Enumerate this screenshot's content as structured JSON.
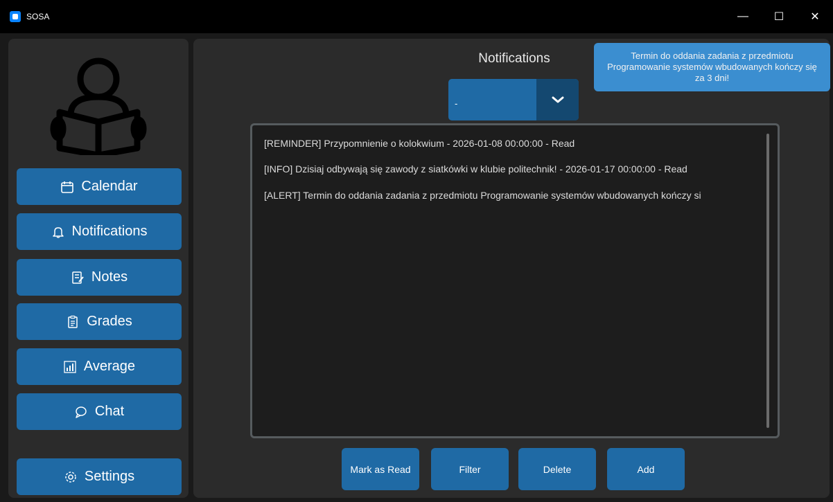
{
  "window": {
    "title": "SOSA",
    "minimize": "—",
    "maximize": "☐",
    "close": "✕"
  },
  "sidebar": {
    "items": [
      {
        "label": "Calendar",
        "icon": "calendar-icon",
        "glyph": "📅"
      },
      {
        "label": "Notifications",
        "icon": "bell-icon",
        "glyph": "🔔"
      },
      {
        "label": "Notes",
        "icon": "notes-icon",
        "glyph": "📝"
      },
      {
        "label": "Grades",
        "icon": "grades-icon",
        "glyph": "📋"
      },
      {
        "label": "Average",
        "icon": "chart-icon",
        "glyph": "📊"
      },
      {
        "label": "Chat",
        "icon": "chat-icon",
        "glyph": "💬"
      }
    ],
    "settings": {
      "label": "Settings",
      "icon": "gear-icon",
      "glyph": "⚙"
    }
  },
  "main": {
    "title": "Notifications",
    "filter_dropdown": {
      "value": "-"
    },
    "toast": "Termin do oddania zadania z przedmiotu Programowanie systemów wbudowanych kończy się za 3 dni!",
    "notifications": [
      "[REMINDER] Przypomnienie o kolokwium - 2026-01-08 00:00:00 - Read",
      "[INFO] Dzisiaj odbywają się zawody z siatkówki w klubie politechnik!  - 2026-01-17 00:00:00 - Read",
      "[ALERT] Termin do oddania zadania z przedmiotu Programowanie systemów wbudowanych kończy si"
    ],
    "actions": {
      "mark_read": "Mark as Read",
      "filter": "Filter",
      "delete": "Delete",
      "add": "Add"
    }
  },
  "colors": {
    "accent": "#1f6aa5",
    "panel": "#2b2b2b",
    "toast": "#3b8ed0"
  }
}
